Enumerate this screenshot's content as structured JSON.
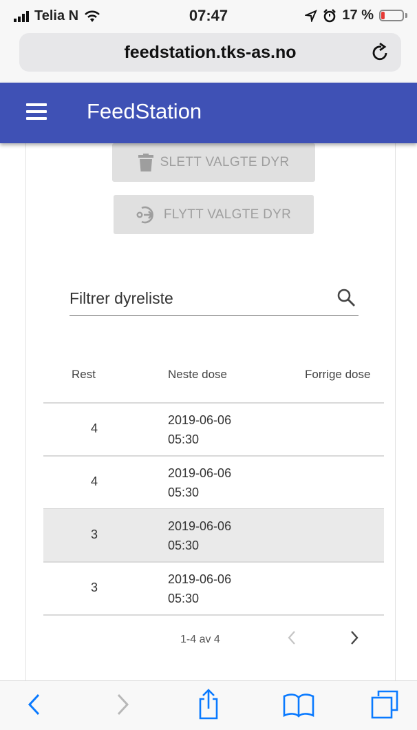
{
  "status": {
    "carrier": "Telia N",
    "time": "07:47",
    "battery": "17 %",
    "battery_level": 0.17,
    "battery_color": "#e53935"
  },
  "browser": {
    "url": "feedstation.tks-as.no",
    "reload_icon": "reload-icon"
  },
  "appbar": {
    "title": "FeedStation",
    "color": "#3f51b5",
    "menu_icon": "hamburger-menu-icon"
  },
  "actions": {
    "delete_label": "SLETT VALGTE DYR",
    "delete_icon": "trash-icon",
    "move_label": "FLYTT VALGTE DYR",
    "move_icon": "move-icon"
  },
  "filter": {
    "placeholder": "Filtrer dyreliste",
    "icon": "search-icon"
  },
  "table": {
    "headers": [
      "Rest",
      "Neste dose",
      "Forrige dose"
    ],
    "rows": [
      {
        "rest": "4",
        "next_date": "2019-06-06",
        "next_time": "05:30",
        "prev": "",
        "selected": false
      },
      {
        "rest": "4",
        "next_date": "2019-06-06",
        "next_time": "05:30",
        "prev": "",
        "selected": false
      },
      {
        "rest": "3",
        "next_date": "2019-06-06",
        "next_time": "05:30",
        "prev": "",
        "selected": true
      },
      {
        "rest": "3",
        "next_date": "2019-06-06",
        "next_time": "05:30",
        "prev": "",
        "selected": false
      }
    ]
  },
  "pager": {
    "range": "1-4 av 4",
    "prev_icon": "chevron-left-icon",
    "next_icon": "chevron-right-icon"
  },
  "toolbar": {
    "icons": [
      "back-icon",
      "forward-icon",
      "share-icon",
      "bookmarks-icon",
      "tabs-icon"
    ],
    "accent": "#0a7aff"
  }
}
